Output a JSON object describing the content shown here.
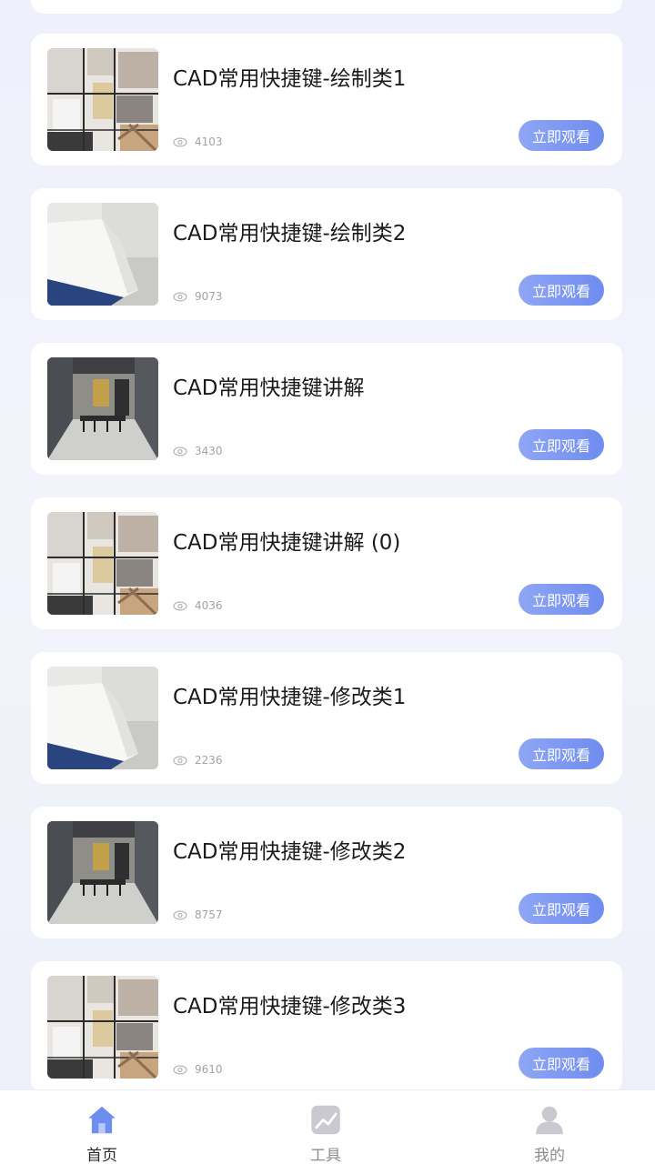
{
  "items": [
    {
      "title": "CAD常用快捷键-绘制类1",
      "views": "4103",
      "button": "立即观看",
      "thumb": "floor-plan"
    },
    {
      "title": "CAD常用快捷键-绘制类2",
      "views": "9073",
      "button": "立即观看",
      "thumb": "white-desk"
    },
    {
      "title": "CAD常用快捷键讲解",
      "views": "3430",
      "button": "立即观看",
      "thumb": "office-room"
    },
    {
      "title": "CAD常用快捷键讲解 (0)",
      "views": "4036",
      "button": "立即观看",
      "thumb": "floor-plan"
    },
    {
      "title": "CAD常用快捷键-修改类1",
      "views": "2236",
      "button": "立即观看",
      "thumb": "white-desk"
    },
    {
      "title": "CAD常用快捷键-修改类2",
      "views": "8757",
      "button": "立即观看",
      "thumb": "office-room"
    },
    {
      "title": "CAD常用快捷键-修改类3",
      "views": "9610",
      "button": "立即观看",
      "thumb": "floor-plan"
    }
  ],
  "view_icon": "eye-icon",
  "tabbar": {
    "home_label": "首页",
    "tools_label": "工具",
    "mine_label": "我的",
    "home_icon": "home-icon",
    "tools_icon": "chart-icon",
    "mine_icon": "user-icon",
    "active_tab": "home"
  },
  "colors": {
    "accent": "#6f8cef",
    "active_icon": "#6f8cef",
    "inactive_icon": "#c9c9cf"
  }
}
